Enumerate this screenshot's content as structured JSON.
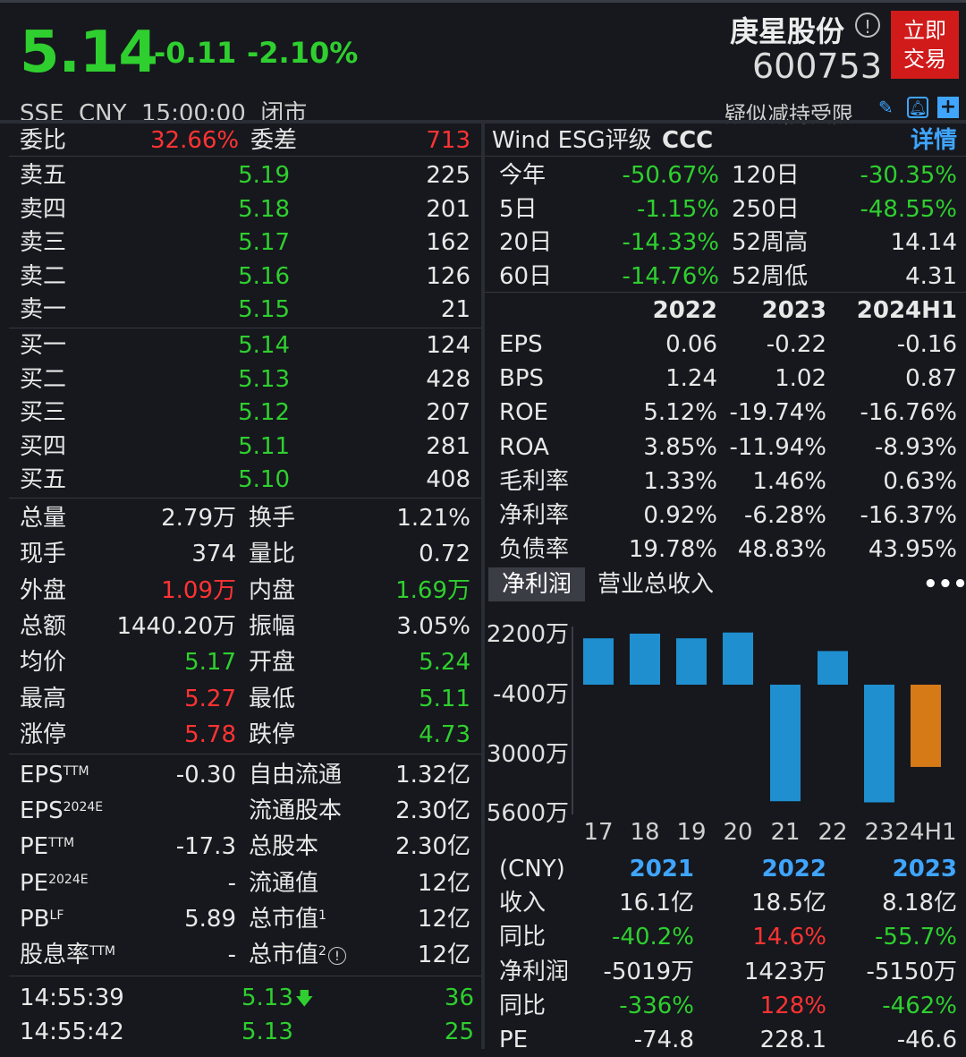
{
  "header": {
    "price": "5.14",
    "change": "-0.11",
    "change_pct": "-2.10%",
    "meta": "SSE  CNY  15:00:00  闭市",
    "name": "庚星股份",
    "code": "600753",
    "trade_button": "立即\n交易",
    "trade_line1": "立即",
    "trade_line2": "交易",
    "notice": "疑似减持受限",
    "icons": [
      "info-icon",
      "edit-icon",
      "bell-icon",
      "plus-icon"
    ]
  },
  "orderbook": {
    "weibi_label": "委比",
    "weibi_value": "32.66%",
    "weicha_label": "委差",
    "weicha_value": "713",
    "sell": [
      {
        "label": "卖五",
        "price": "5.19",
        "vol": "225"
      },
      {
        "label": "卖四",
        "price": "5.18",
        "vol": "201"
      },
      {
        "label": "卖三",
        "price": "5.17",
        "vol": "162"
      },
      {
        "label": "卖二",
        "price": "5.16",
        "vol": "126"
      },
      {
        "label": "卖一",
        "price": "5.15",
        "vol": "21"
      }
    ],
    "buy": [
      {
        "label": "买一",
        "price": "5.14",
        "vol": "124"
      },
      {
        "label": "买二",
        "price": "5.13",
        "vol": "428"
      },
      {
        "label": "买三",
        "price": "5.12",
        "vol": "207"
      },
      {
        "label": "买四",
        "price": "5.11",
        "vol": "281"
      },
      {
        "label": "买五",
        "price": "5.10",
        "vol": "408"
      }
    ]
  },
  "stats": [
    {
      "l1": "总量",
      "v1": "2.79万",
      "l2": "换手",
      "v2": "1.21%"
    },
    {
      "l1": "现手",
      "v1": "374",
      "l2": "量比",
      "v2": "0.72"
    },
    {
      "l1": "外盘",
      "v1": "1.09万",
      "l2": "内盘",
      "v2": "1.69万"
    },
    {
      "l1": "总额",
      "v1": "1440.20万",
      "l2": "振幅",
      "v2": "3.05%"
    },
    {
      "l1": "均价",
      "v1": "5.17",
      "l2": "开盘",
      "v2": "5.24"
    },
    {
      "l1": "最高",
      "v1": "5.27",
      "l2": "最低",
      "v2": "5.11"
    },
    {
      "l1": "涨停",
      "v1": "5.78",
      "l2": "跌停",
      "v2": "4.73"
    }
  ],
  "fundamentals": [
    {
      "l1": "EPS",
      "s1": "TTM",
      "v1": "-0.30",
      "l2": "自由流通",
      "s2": "",
      "v2": "1.32亿"
    },
    {
      "l1": "EPS",
      "s1": "2024E",
      "v1": "",
      "l2": "流通股本",
      "s2": "",
      "v2": "2.30亿"
    },
    {
      "l1": "PE",
      "s1": "TTM",
      "v1": "-17.3",
      "l2": "总股本",
      "s2": "",
      "v2": "2.30亿"
    },
    {
      "l1": "PE",
      "s1": "2024E",
      "v1": "-",
      "l2": "流通值",
      "s2": "",
      "v2": "12亿"
    },
    {
      "l1": "PB",
      "s1": "LF",
      "v1": "5.89",
      "l2": "总市值",
      "s2": "1",
      "v2": "12亿"
    },
    {
      "l1": "股息率",
      "s1": "TTM",
      "v1": "-",
      "l2": "总市值",
      "s2": "2",
      "v2": "12亿"
    }
  ],
  "ticks": [
    {
      "time": "14:55:39",
      "price": "5.13",
      "arrow": "🡇",
      "vol": "36"
    },
    {
      "time": "14:55:42",
      "price": "5.13",
      "arrow": "",
      "vol": "25"
    }
  ],
  "esg": {
    "label": "Wind ESG评级",
    "rating": "CCC",
    "detail": "详情"
  },
  "returns": [
    {
      "l1": "今年",
      "v1": "-50.67%",
      "l2": "120日",
      "v2": "-30.35%"
    },
    {
      "l1": "5日",
      "v1": "-1.15%",
      "l2": "250日",
      "v2": "-48.55%"
    },
    {
      "l1": "20日",
      "v1": "-14.33%",
      "l2": "52周高",
      "v2": "14.14"
    },
    {
      "l1": "60日",
      "v1": "-14.76%",
      "l2": "52周低",
      "v2": "4.31"
    }
  ],
  "financials": {
    "years": [
      "2022",
      "2023",
      "2024H1"
    ],
    "rows": [
      {
        "label": "EPS",
        "vals": [
          "0.06",
          "-0.22",
          "-0.16"
        ]
      },
      {
        "label": "BPS",
        "vals": [
          "1.24",
          "1.02",
          "0.87"
        ]
      },
      {
        "label": "ROE",
        "vals": [
          "5.12%",
          "-19.74%",
          "-16.76%"
        ]
      },
      {
        "label": "ROA",
        "vals": [
          "3.85%",
          "-11.94%",
          "-8.93%"
        ]
      },
      {
        "label": "毛利率",
        "vals": [
          "1.33%",
          "1.46%",
          "0.63%"
        ]
      },
      {
        "label": "净利率",
        "vals": [
          "0.92%",
          "-6.28%",
          "-16.37%"
        ]
      },
      {
        "label": "负债率",
        "vals": [
          "19.78%",
          "48.83%",
          "43.95%"
        ]
      }
    ]
  },
  "chart_tabs": {
    "active": "净利润",
    "other": "营业总收入"
  },
  "colors": {
    "bar_positive": "#1f8fd0",
    "bar_forecast": "#d67a18",
    "green": "#2fcf2f",
    "red": "#ff3333",
    "blue": "#3fa5ff"
  },
  "chart_data": {
    "type": "bar",
    "categories": [
      "17",
      "18",
      "19",
      "20",
      "21",
      "22",
      "23",
      "24H1"
    ],
    "values": [
      2000,
      2200,
      2000,
      2250,
      -5100,
      1450,
      -5150,
      -3600
    ],
    "ytick_labels": [
      "2200万",
      "-400万",
      "3000万",
      "5600万"
    ],
    "ytick_values": [
      2200,
      -400,
      -3000,
      -5600
    ],
    "ylim": [
      -5600,
      2200
    ]
  },
  "annual": {
    "unit": "(CNY)",
    "years": [
      "2021",
      "2022",
      "2023"
    ],
    "rows": [
      {
        "label": "收入",
        "vals": [
          "16.1亿",
          "18.5亿",
          "8.18亿"
        ]
      },
      {
        "label": "同比",
        "vals": [
          "-40.2%",
          "14.6%",
          "-55.7%"
        ]
      },
      {
        "label": "净利润",
        "vals": [
          "-5019万",
          "1423万",
          "-5150万"
        ]
      },
      {
        "label": "同比",
        "vals": [
          "-336%",
          "128%",
          "-462%"
        ]
      },
      {
        "label": "PE",
        "vals": [
          "-74.8",
          "228.1",
          "-46.6"
        ]
      }
    ]
  }
}
